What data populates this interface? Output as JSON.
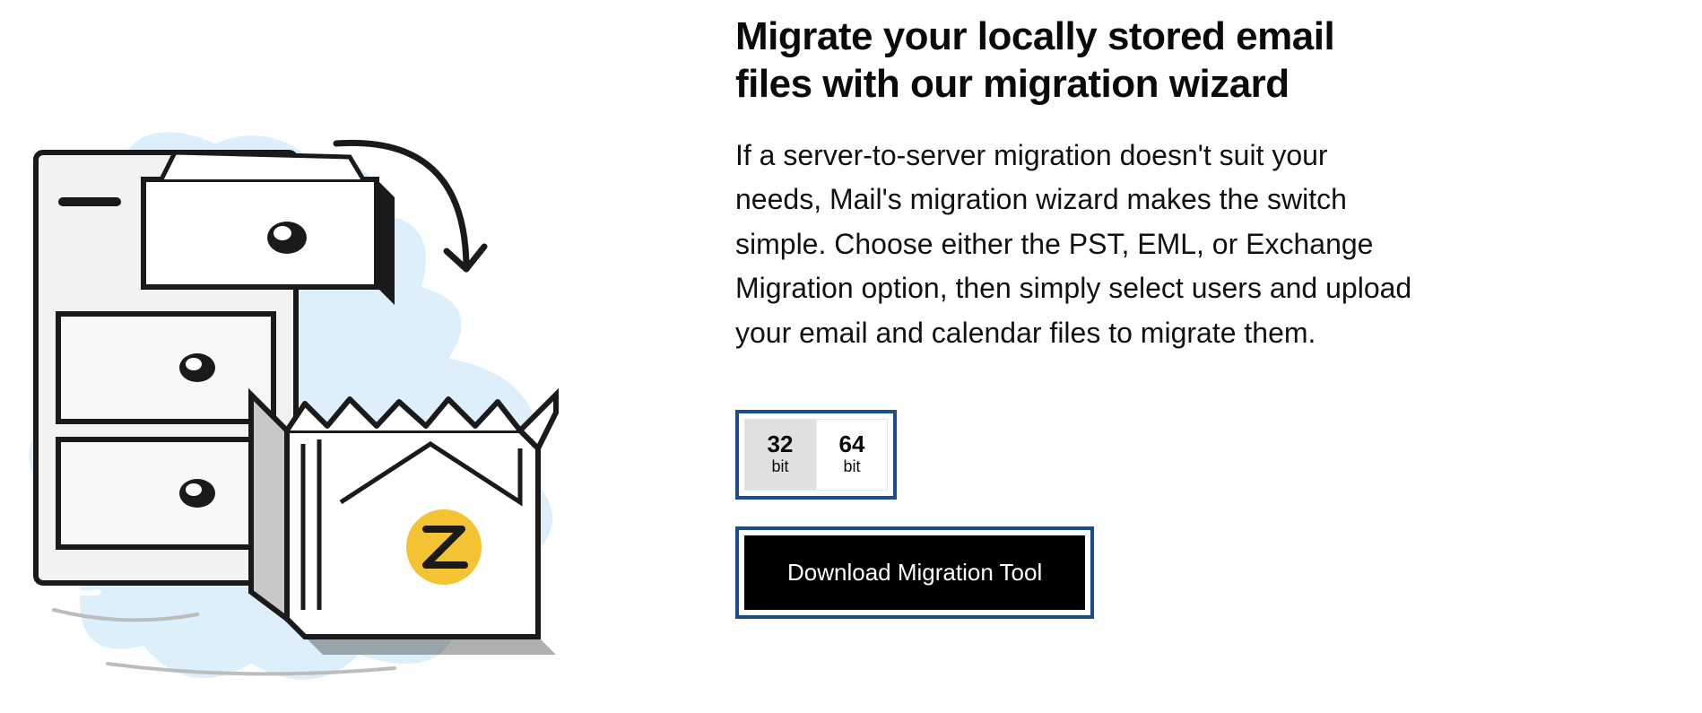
{
  "heading": "Migrate your locally stored email files with our migration wizard",
  "body": "If a server-to-server migration doesn't suit your needs, Mail's migration wizard makes the switch simple. Choose either the PST, EML, or Exchange Migration option, then simply select users and upload your email and calendar files to migrate them.",
  "bit_options": [
    {
      "num": "32",
      "label": "bit",
      "selected": true
    },
    {
      "num": "64",
      "label": "bit",
      "selected": false
    }
  ],
  "download_label": "Download Migration Tool",
  "accent_color": "#1a4d8f",
  "illustration_alt": "Sketch of a filing cabinet with a drawer open and an arrow pointing to an open box with a Z-labeled envelope inside"
}
